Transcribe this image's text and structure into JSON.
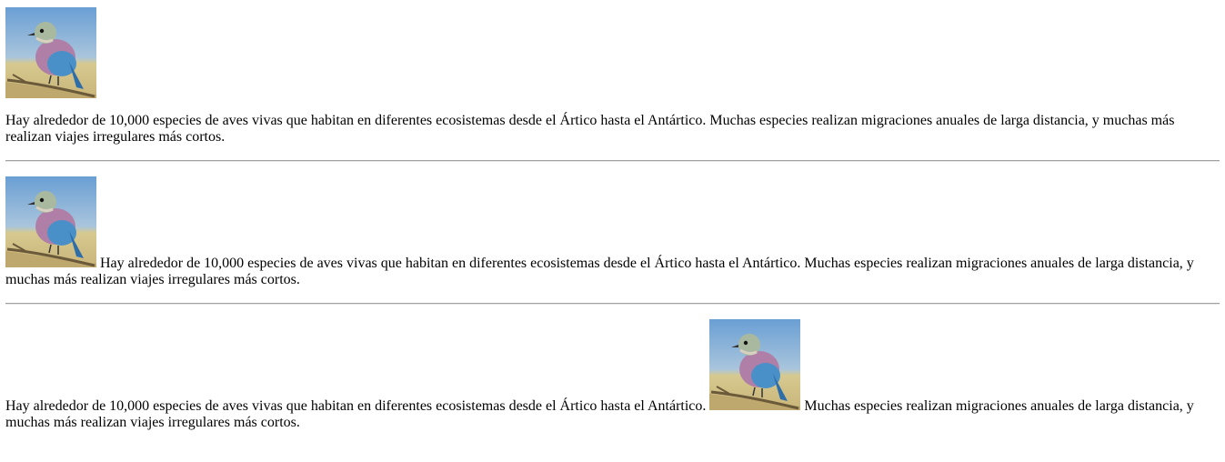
{
  "image": {
    "alt_icon": "bird-photo"
  },
  "sections": [
    {
      "layout": "image-above-text",
      "text": "Hay alrededor de 10,000 especies de aves vivas que habitan en diferentes ecosistemas desde el Ártico hasta el Antártico. Muchas especies realizan migraciones anuales de larga distancia, y muchas más realizan viajes irregulares más cortos."
    },
    {
      "layout": "image-inline-start",
      "text": "Hay alrededor de 10,000 especies de aves vivas que habitan en diferentes ecosistemas desde el Ártico hasta el Antártico. Muchas especies realizan migraciones anuales de larga distancia, y muchas más realizan viajes irregulares más cortos."
    },
    {
      "layout": "image-inline-middle",
      "text_before": "Hay alrededor de 10,000 especies de aves vivas que habitan en diferentes ecosistemas desde el Ártico hasta el Antártico.",
      "text_after": "Muchas especies realizan migraciones anuales de larga distancia, y muchas más realizan viajes irregulares más cortos."
    }
  ]
}
